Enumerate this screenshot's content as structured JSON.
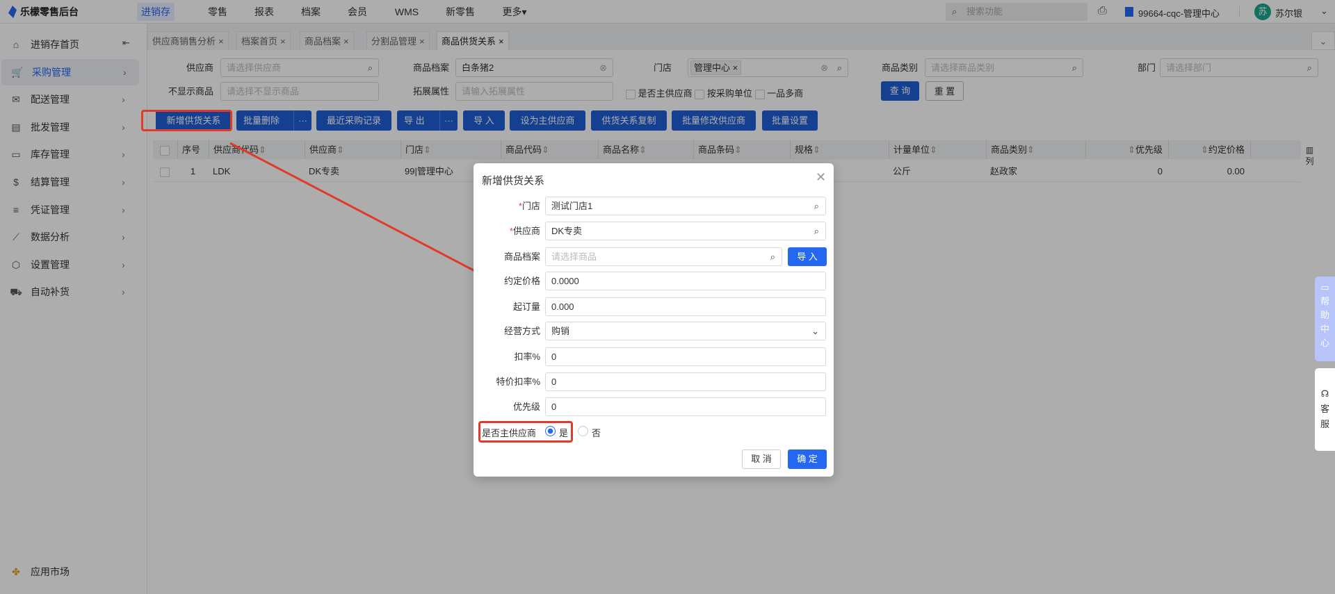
{
  "header": {
    "app_name": "乐檬零售后台",
    "nav": [
      "进销存",
      "零售",
      "报表",
      "档案",
      "会员",
      "WMS",
      "新零售",
      "更多▾"
    ],
    "search_placeholder": "搜索功能",
    "store": "99664-cqc-管理中心",
    "user": "苏尔银",
    "avatar_char": "苏"
  },
  "sidebar": {
    "items": [
      {
        "label": "进销存首页",
        "icon": "home-icon"
      },
      {
        "label": "采购管理",
        "icon": "cart-icon"
      },
      {
        "label": "配送管理",
        "icon": "delivery-icon"
      },
      {
        "label": "批发管理",
        "icon": "wholesale-icon"
      },
      {
        "label": "库存管理",
        "icon": "inventory-icon"
      },
      {
        "label": "结算管理",
        "icon": "dollar-icon"
      },
      {
        "label": "凭证管理",
        "icon": "voucher-icon"
      },
      {
        "label": "数据分析",
        "icon": "chart-icon"
      },
      {
        "label": "设置管理",
        "icon": "settings-icon"
      },
      {
        "label": "自动补货",
        "icon": "replenish-icon"
      }
    ],
    "app_market": "应用市场"
  },
  "tabs": [
    "供应商销售分析",
    "档案首页",
    "商品档案",
    "分割品管理",
    "商品供货关系"
  ],
  "filters": {
    "supplier_label": "供应商",
    "supplier_ph": "请选择供应商",
    "product_label": "商品档案",
    "product_value": "白条猪2",
    "store_label": "门店",
    "store_tag": "管理中心",
    "category_label": "商品类别",
    "category_ph": "请选择商品类别",
    "dept_label": "部门",
    "dept_ph": "请选择部门",
    "hide_label": "不显示商品",
    "hide_ph": "请选择不显示商品",
    "ext_label": "拓展属性",
    "ext_ph": "请输入拓展属性",
    "chk_main": "是否主供应商",
    "chk_unit": "按采购单位",
    "chk_multi": "一品多商",
    "query": "查 询",
    "reset": "重 置"
  },
  "toolbar": [
    "新增供货关系",
    "批量删除",
    "最近采购记录",
    "导 出",
    "导 入",
    "设为主供应商",
    "供货关系复制",
    "批量修改供应商",
    "批量设置"
  ],
  "table": {
    "columns": [
      "序号",
      "供应商代码",
      "供应商",
      "门店",
      "商品代码",
      "商品名称",
      "商品条码",
      "规格",
      "计量单位",
      "商品类别",
      "优先级",
      "约定价格"
    ],
    "col_setting": "列",
    "rows": [
      [
        "1",
        "LDK",
        "DK专卖",
        "99|管理中心",
        "",
        "",
        "",
        "",
        "公斤",
        "赵政家",
        "0",
        "0.00"
      ]
    ]
  },
  "dialog": {
    "title": "新增供货关系",
    "fields": [
      {
        "label": "门店",
        "required": true,
        "value": "测试门店1",
        "placeholder": ""
      },
      {
        "label": "供应商",
        "required": true,
        "value": "DK专卖",
        "placeholder": ""
      },
      {
        "label": "商品档案",
        "required": false,
        "value": "",
        "placeholder": "请选择商品"
      },
      {
        "label": "约定价格",
        "required": false,
        "value": "0.0000"
      },
      {
        "label": "起订量",
        "required": false,
        "value": "0.000"
      },
      {
        "label": "经营方式",
        "required": false,
        "value": "购销"
      },
      {
        "label": "扣率%",
        "required": false,
        "value": "0"
      },
      {
        "label": "特价扣率%",
        "required": false,
        "value": "0"
      },
      {
        "label": "优先级",
        "required": false,
        "value": "0"
      }
    ],
    "import": "导 入",
    "main_label": "是否主供应商",
    "yes": "是",
    "no": "否",
    "cancel": "取 消",
    "confirm": "确 定"
  },
  "float": {
    "help": [
      "帮",
      "助",
      "中",
      "心"
    ],
    "service": [
      "客",
      "服"
    ]
  },
  "colors": {
    "brand": "#1f5fd6",
    "dialog_primary": "#2468f2",
    "annotation": "#e03a2a"
  }
}
